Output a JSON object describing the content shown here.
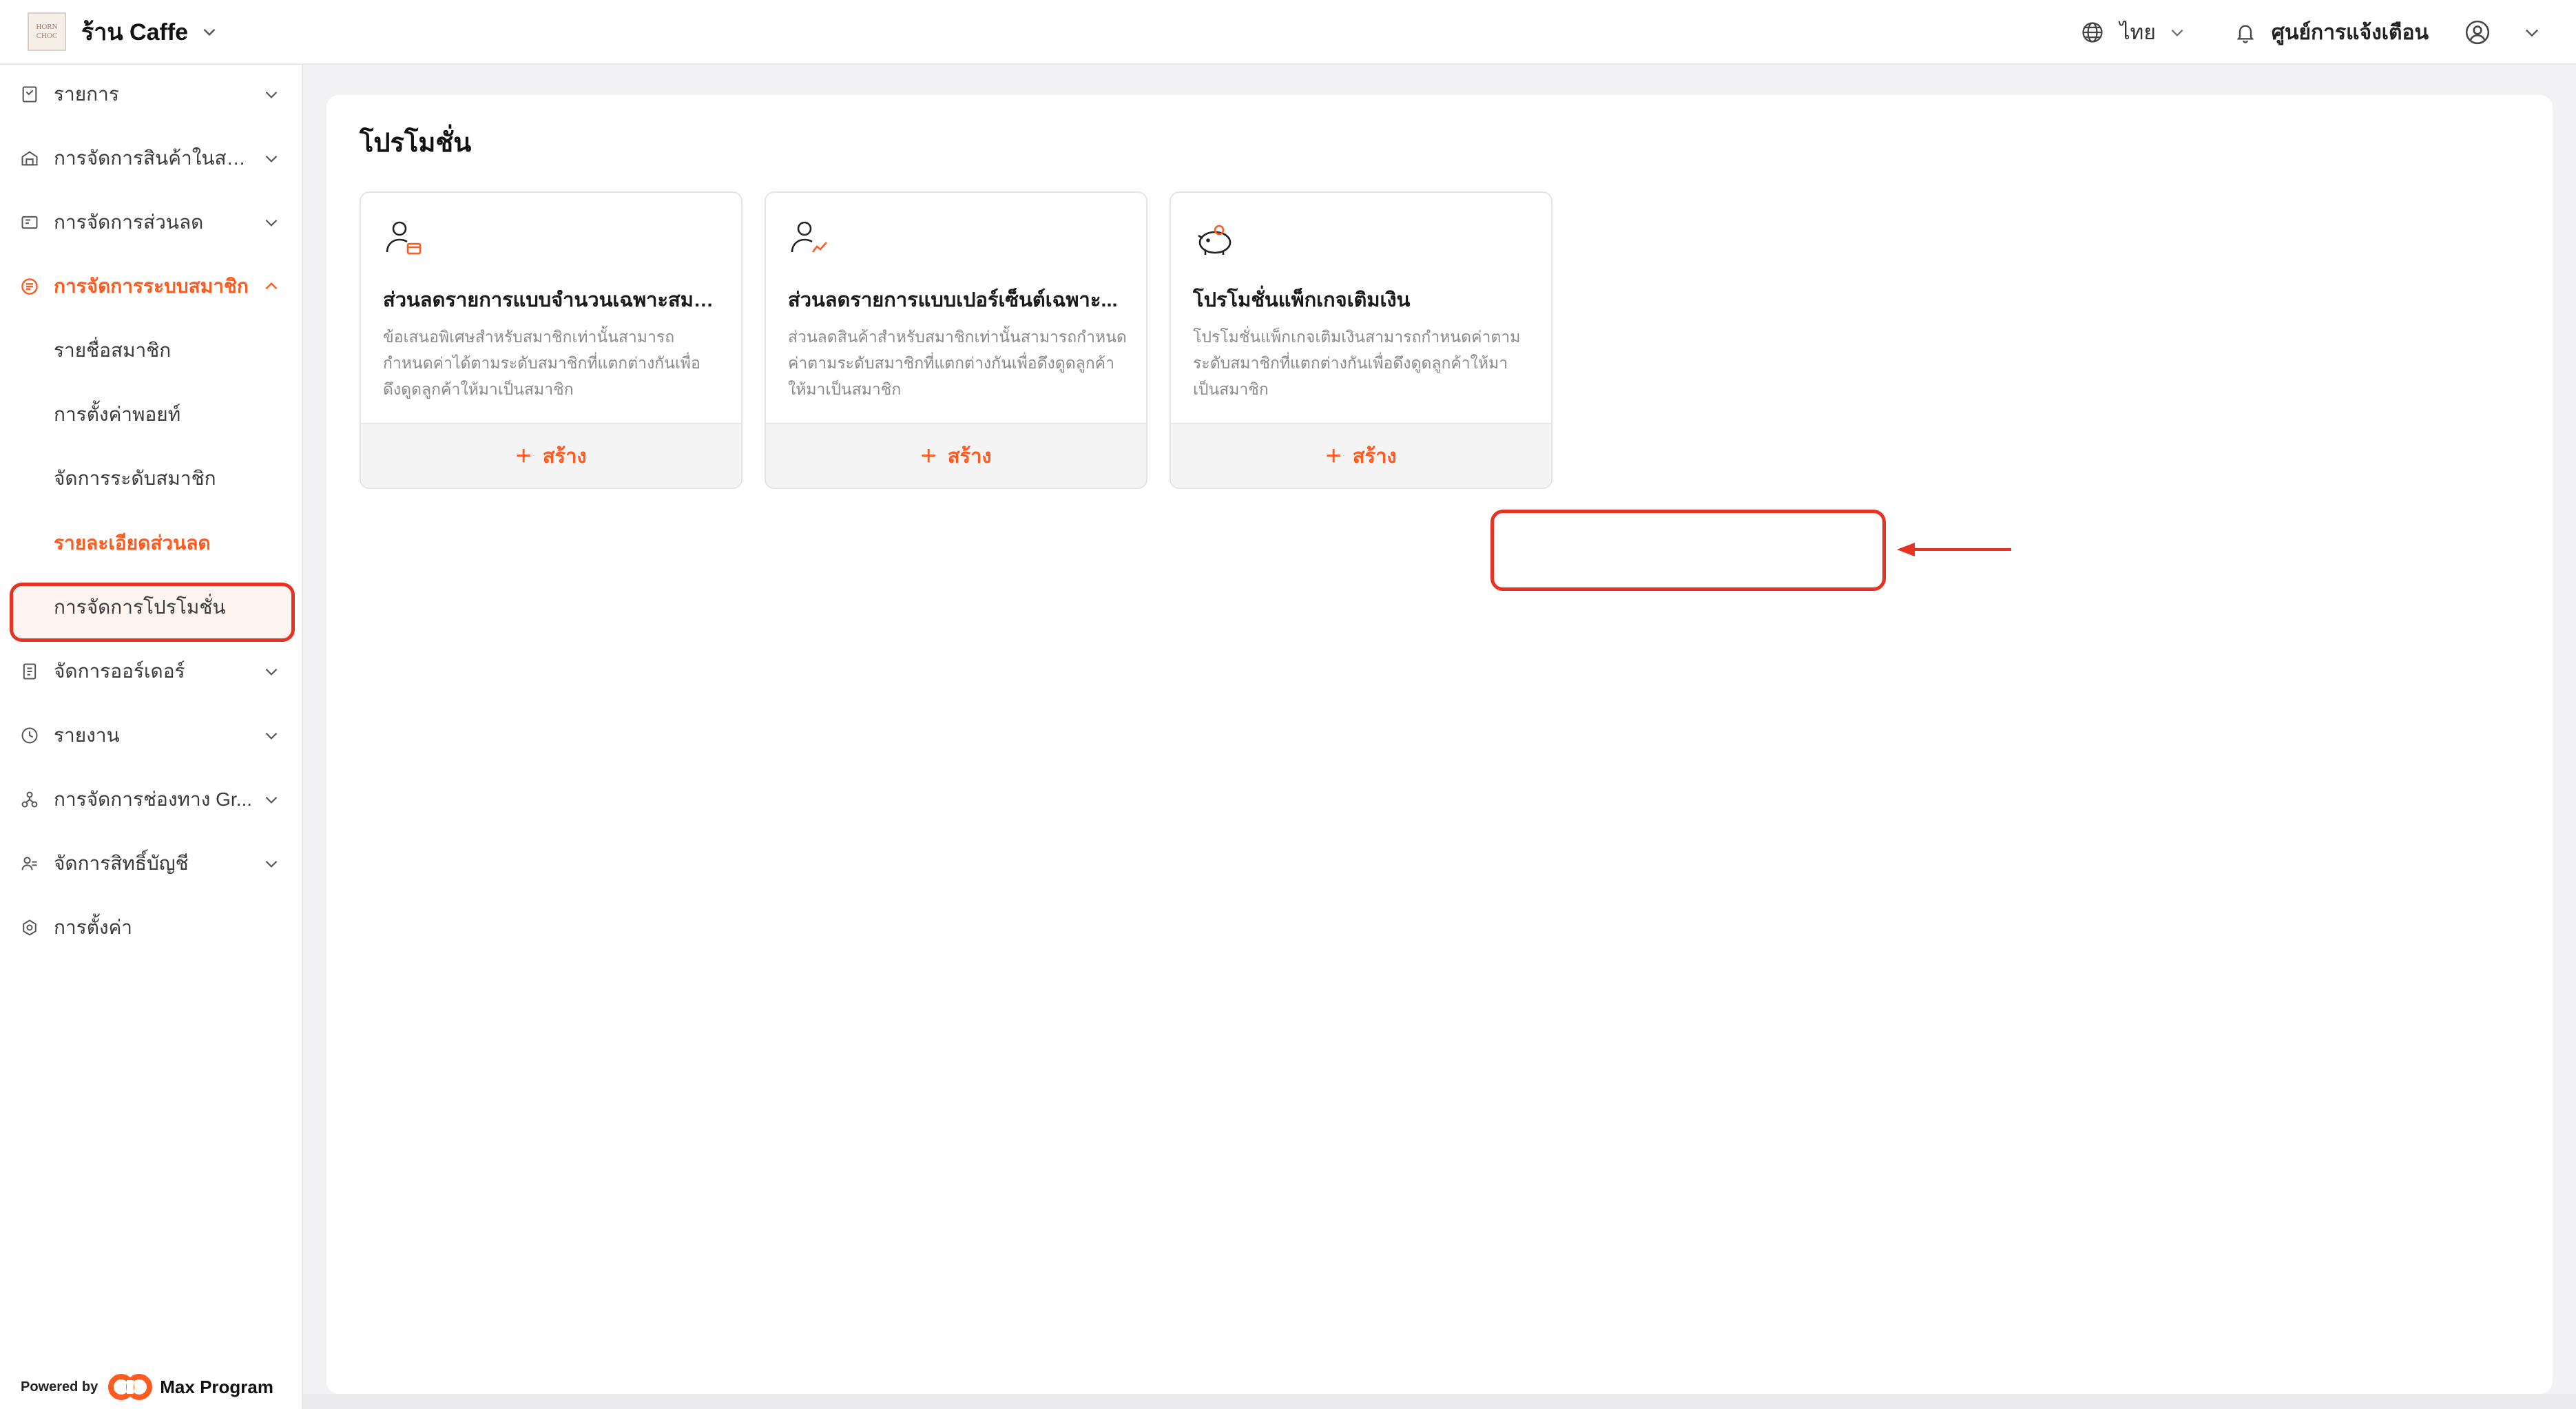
{
  "header": {
    "brand_logo_text": [
      "HORN",
      "CHOC"
    ],
    "store_name": "ร้าน Caffe",
    "language": "ไทย",
    "notification_center": "ศูนย์การแจ้งเตือน"
  },
  "sidebar": {
    "items": [
      {
        "label": "รายการ",
        "icon": "receipt-icon",
        "expanded": false
      },
      {
        "label": "การจัดการสินค้าในสต๊...",
        "icon": "store-icon",
        "expanded": false
      },
      {
        "label": "การจัดการส่วนลด",
        "icon": "discount-icon",
        "expanded": false
      },
      {
        "label": "การจัดการระบบสมาชิก",
        "icon": "member-icon",
        "expanded": true,
        "active": true
      },
      {
        "label": "จัดการออร์เดอร์",
        "icon": "order-icon",
        "expanded": false
      },
      {
        "label": "รายงาน",
        "icon": "clock-icon",
        "expanded": false
      },
      {
        "label": "การจัดการช่องทาง Gr...",
        "icon": "channel-icon",
        "expanded": false
      },
      {
        "label": "จัดการสิทธิ์บัญชี",
        "icon": "account-icon",
        "expanded": false
      },
      {
        "label": "การตั้งค่า",
        "icon": "settings-icon"
      }
    ],
    "subitems": [
      {
        "label": "รายชื่อสมาชิก"
      },
      {
        "label": "การตั้งค่าพอยท์"
      },
      {
        "label": "จัดการระดับสมาชิก"
      },
      {
        "label": "รายละเอียดส่วนลด",
        "selected": true
      },
      {
        "label": "การจัดการโปรโมชั่น"
      }
    ],
    "powered_by": "Powered by",
    "powered_brand": "Max Program"
  },
  "main": {
    "title": "โปรโมชั่น",
    "cards": [
      {
        "icon": "member-card-icon",
        "title": "ส่วนลดรายการแบบจำนวนเฉพาะสมาชิก...",
        "description": "ข้อเสนอพิเศษสำหรับสมาชิกเท่านั้นสามารถกำหนดค่าได้ตามระดับสมาชิกที่แตกต่างกันเพื่อดึงดูดลูกค้าให้มาเป็นสมาชิก",
        "button": "สร้าง"
      },
      {
        "icon": "member-percent-icon",
        "title": "ส่วนลดรายการแบบเปอร์เซ็นต์เฉพาะ...",
        "description": "ส่วนลดสินค้าสำหรับสมาชิกเท่านั้นสามารถกำหนดค่าตามระดับสมาชิกที่แตกต่างกันเพื่อดึงดูดลูกค้าให้มาเป็นสมาชิก",
        "button": "สร้าง"
      },
      {
        "icon": "piggy-bank-icon",
        "title": "โปรโมชั่นแพ็กเกจเติมเงิน",
        "description": "โปรโมชั่นแพ็กเกจเติมเงินสามารถกำหนดค่าตามระดับสมาชิกที่แตกต่างกันเพื่อดึงดูดลูกค้าให้มาเป็นสมาชิก",
        "button": "สร้าง"
      }
    ]
  },
  "colors": {
    "accent": "#ff5a1f",
    "highlight": "#e53222",
    "background": "#f2f2f4"
  }
}
